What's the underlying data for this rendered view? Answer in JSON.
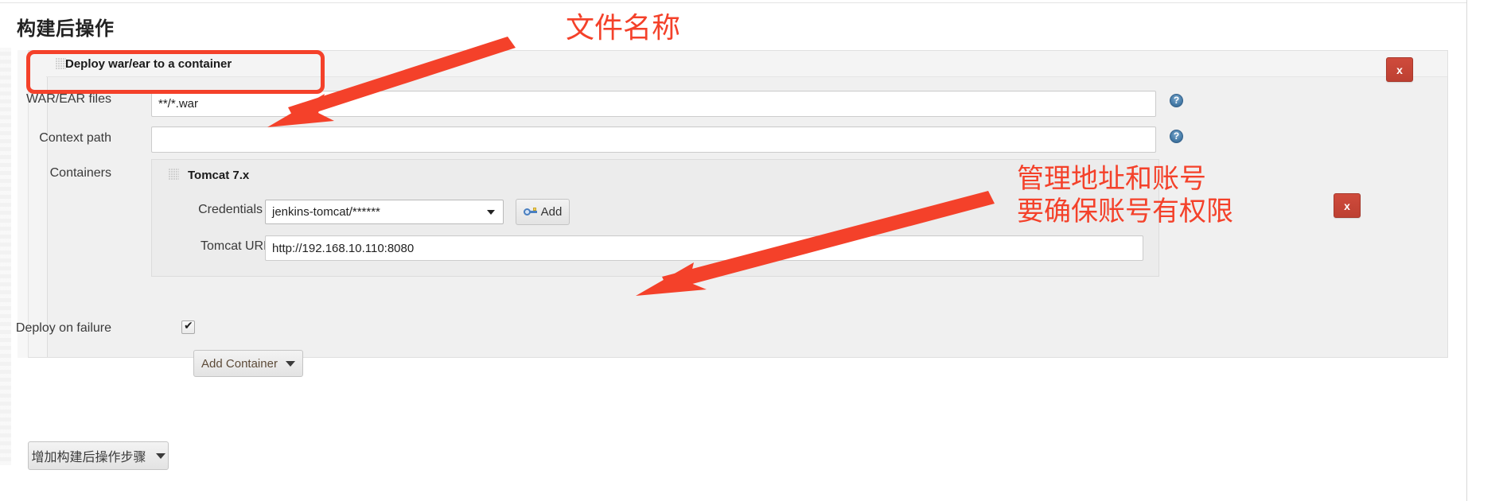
{
  "page": {
    "section_title": "构建后操作"
  },
  "plugin": {
    "title": "Deploy war/ear to a container",
    "close_label": "x",
    "drag_icon": "drag-dots-icon"
  },
  "fields": {
    "war_label": "WAR/EAR files",
    "war_value": "**/*.war",
    "war_help": "?",
    "context_label": "Context path",
    "context_value": "",
    "context_help": "?",
    "containers_label": "Containers",
    "deploy_on_failure_label": "Deploy on failure",
    "deploy_on_failure_checked": true
  },
  "container": {
    "title": "Tomcat 7.x",
    "close_label": "x",
    "credentials_label": "Credentials",
    "credentials_value": "jenkins-tomcat/******",
    "add_credentials_label": "Add",
    "add_credentials_icon": "key-icon",
    "url_label": "Tomcat URL",
    "url_value": "http://192.168.10.110:8080"
  },
  "buttons": {
    "add_container": "Add Container",
    "add_post_build_step": "增加构建后操作步骤",
    "caret_icon": "chevron-down-icon"
  },
  "annotations": {
    "file_name": "文件名称",
    "admin_line1": "管理地址和账号",
    "admin_line2": "要确保账号有权限",
    "color": "#f4412a"
  },
  "colors": {
    "annotation_red": "#f4412a",
    "close_button_red": "#c5453a",
    "panel_bg": "#f0f0f0",
    "container_bg": "#ececec",
    "help_blue": "#4a7fab"
  }
}
